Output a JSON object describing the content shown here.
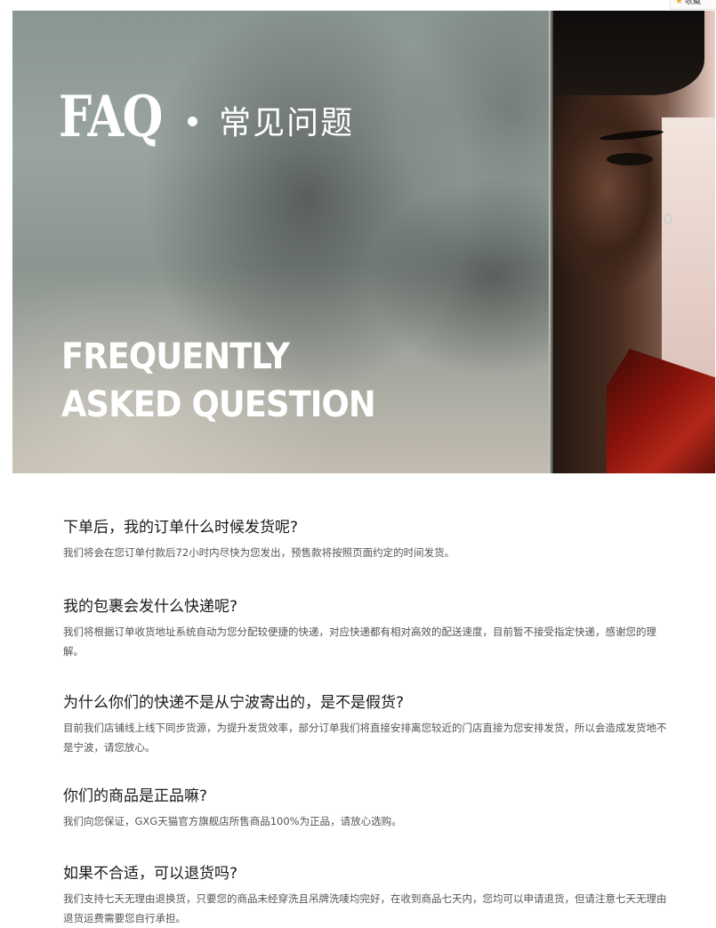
{
  "fav_tab": {
    "label": "收藏",
    "icon": "star-icon"
  },
  "hero": {
    "faq": "FAQ",
    "faq_cn": "常见问题",
    "heading_line1": "FREQUENTLY",
    "heading_line2": "ASKED QUESTION"
  },
  "qa": [
    {
      "q": "下单后，我的订单什么时候发货呢?",
      "a": "我们将会在您订单付款后72小时内尽快为您发出，预售款将按照页面约定的时间发货。"
    },
    {
      "q": "我的包裹会发什么快递呢?",
      "a": "我们将根据订单收货地址系统自动为您分配较便捷的快递，对应快递都有相对高效的配送速度，目前暂不接受指定快递，感谢您的理解。"
    },
    {
      "q": "为什么你们的快递不是从宁波寄出的，是不是假货?",
      "a": "目前我们店铺线上线下同步货源，为提升发货效率，部分订单我们将直接安排离您较近的门店直接为您安排发货，所以会造成发货地不是宁波，请您放心。"
    },
    {
      "q": "你们的商品是正品嘛?",
      "a": "我们向您保证，GXG天猫官方旗舰店所售商品100%为正品，请放心选购。"
    },
    {
      "q": "如果不合适，可以退货吗?",
      "a": "我们支持七天无理由退换货，只要您的商品未经穿洗且吊牌洗唛均完好，在收到商品七天内，您均可以申请退货，但请注意七天无理由退货运费需要您自行承担。"
    }
  ]
}
